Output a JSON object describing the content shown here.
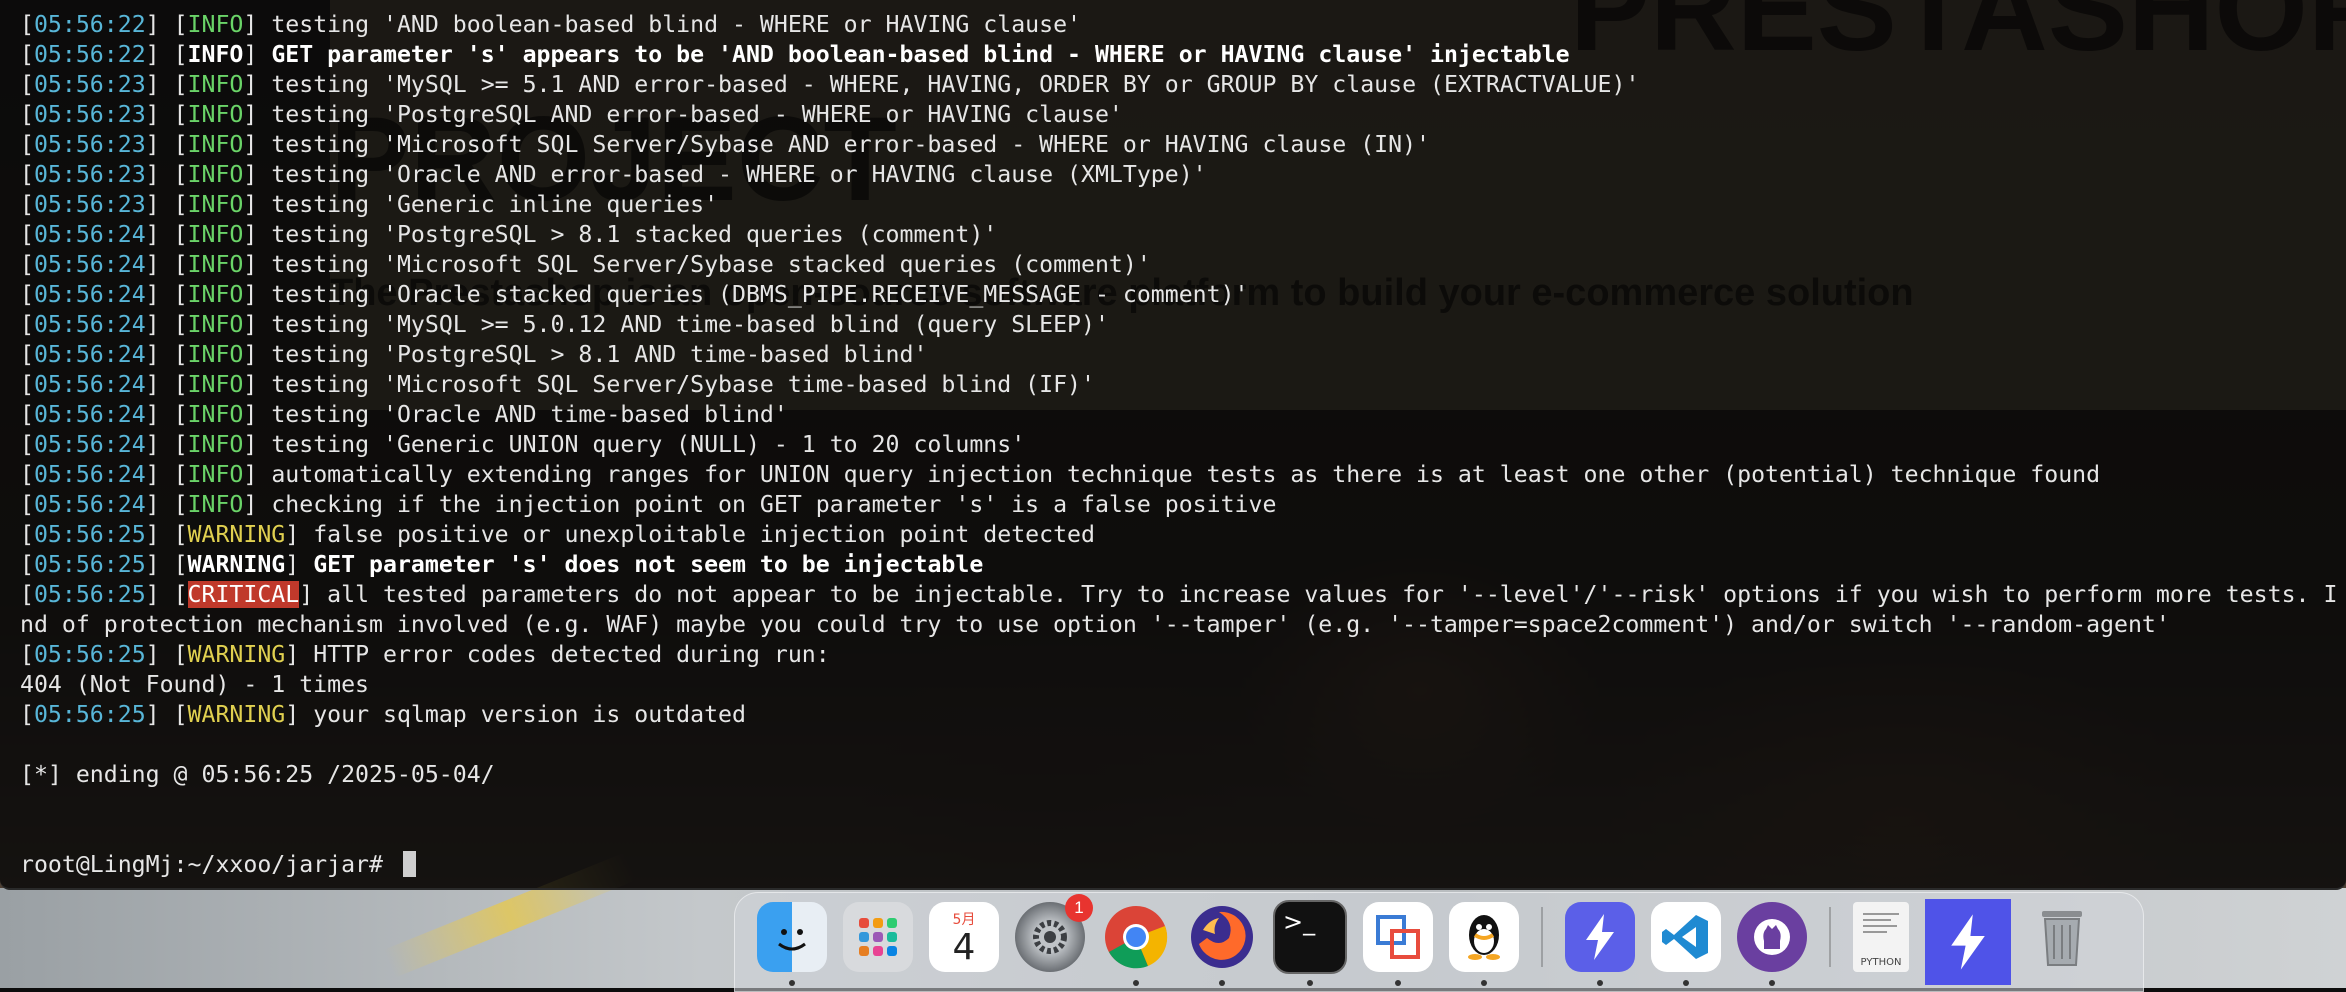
{
  "terminal": {
    "lines": [
      {
        "ts": "05:56:22",
        "level": "INFO",
        "text": "testing 'AND boolean-based blind - WHERE or HAVING clause'"
      },
      {
        "ts": "05:56:22",
        "level": "INFO",
        "text": "GET parameter 's' appears to be 'AND boolean-based blind - WHERE or HAVING clause' injectable",
        "bold": true
      },
      {
        "ts": "05:56:23",
        "level": "INFO",
        "text": "testing 'MySQL >= 5.1 AND error-based - WHERE, HAVING, ORDER BY or GROUP BY clause (EXTRACTVALUE)'"
      },
      {
        "ts": "05:56:23",
        "level": "INFO",
        "text": "testing 'PostgreSQL AND error-based - WHERE or HAVING clause'"
      },
      {
        "ts": "05:56:23",
        "level": "INFO",
        "text": "testing 'Microsoft SQL Server/Sybase AND error-based - WHERE or HAVING clause (IN)'"
      },
      {
        "ts": "05:56:23",
        "level": "INFO",
        "text": "testing 'Oracle AND error-based - WHERE or HAVING clause (XMLType)'"
      },
      {
        "ts": "05:56:23",
        "level": "INFO",
        "text": "testing 'Generic inline queries'"
      },
      {
        "ts": "05:56:24",
        "level": "INFO",
        "text": "testing 'PostgreSQL > 8.1 stacked queries (comment)'"
      },
      {
        "ts": "05:56:24",
        "level": "INFO",
        "text": "testing 'Microsoft SQL Server/Sybase stacked queries (comment)'"
      },
      {
        "ts": "05:56:24",
        "level": "INFO",
        "text": "testing 'Oracle stacked queries (DBMS_PIPE.RECEIVE_MESSAGE - comment)'"
      },
      {
        "ts": "05:56:24",
        "level": "INFO",
        "text": "testing 'MySQL >= 5.0.12 AND time-based blind (query SLEEP)'"
      },
      {
        "ts": "05:56:24",
        "level": "INFO",
        "text": "testing 'PostgreSQL > 8.1 AND time-based blind'"
      },
      {
        "ts": "05:56:24",
        "level": "INFO",
        "text": "testing 'Microsoft SQL Server/Sybase time-based blind (IF)'"
      },
      {
        "ts": "05:56:24",
        "level": "INFO",
        "text": "testing 'Oracle AND time-based blind'"
      },
      {
        "ts": "05:56:24",
        "level": "INFO",
        "text": "testing 'Generic UNION query (NULL) - 1 to 20 columns'"
      },
      {
        "ts": "05:56:24",
        "level": "INFO",
        "text": "automatically extending ranges for UNION query injection technique tests as there is at least one other (potential) technique found"
      },
      {
        "ts": "05:56:24",
        "level": "INFO",
        "text": "checking if the injection point on GET parameter 's' is a false positive"
      },
      {
        "ts": "05:56:25",
        "level": "WARNING",
        "text": "false positive or unexploitable injection point detected"
      },
      {
        "ts": "05:56:25",
        "level": "WARNING",
        "text": "GET parameter 's' does not seem to be injectable",
        "bold": true
      },
      {
        "ts": "05:56:25",
        "level": "CRITICAL",
        "text": "all tested parameters do not appear to be injectable. Try to increase values for '--level'/'--risk' options if you wish to perform more tests. I"
      },
      {
        "raw": "nd of protection mechanism involved (e.g. WAF) maybe you could try to use option '--tamper' (e.g. '--tamper=space2comment') and/or switch '--random-agent'"
      },
      {
        "ts": "05:56:25",
        "level": "WARNING",
        "text": "HTTP error codes detected during run:"
      },
      {
        "raw": "404 (Not Found) - 1 times"
      },
      {
        "ts": "05:56:25",
        "level": "WARNING",
        "text": "your sqlmap version is outdated"
      },
      {
        "raw": ""
      },
      {
        "raw": "[*] ending @ 05:56:25 /2025-05-04/"
      },
      {
        "raw": ""
      },
      {
        "raw": ""
      },
      {
        "prompt": "root@LingMj:~/xxoo/jarjar# "
      }
    ],
    "colors": {
      "timestamp": "#58b6d8",
      "info": "#6ad468",
      "warning": "#e0d050",
      "critical_bg": "#c0392b"
    }
  },
  "background_page": {
    "heading_top": "PRESTASHOP",
    "heading_mid": "PROJECT",
    "tagline": "The Prestashop is an open-source software platform to build your e-commerce solution"
  },
  "dock": {
    "calendar": {
      "month": "5月",
      "day": "4"
    },
    "settings_badge": "1",
    "python_label": "PYTHON",
    "apps": [
      "finder-icon",
      "launchpad-icon",
      "calendar-icon",
      "system-settings-icon",
      "chrome-icon",
      "firefox-icon",
      "terminal-icon",
      "parallels-icon",
      "qq-icon",
      "thunder-icon",
      "vscode-icon",
      "github-desktop-icon",
      "python-doc-icon",
      "thunder-active-icon",
      "trash-icon"
    ]
  }
}
